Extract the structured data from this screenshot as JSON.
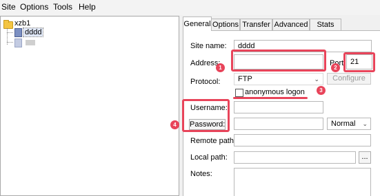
{
  "menu": {
    "items": [
      "Site",
      "Options",
      "Tools",
      "Help"
    ]
  },
  "tree": {
    "root_label": "xzb1",
    "child_label": "dddd"
  },
  "tabs": [
    "General",
    "Options",
    "Transfer",
    "Advanced",
    "Stats"
  ],
  "form": {
    "site_name_label": "Site name:",
    "site_name_value": "dddd",
    "address_label": "Address:",
    "address_value": "",
    "port_label": "Port:",
    "port_value": "21",
    "protocol_label": "Protocol:",
    "protocol_value": "FTP",
    "configure_label": "Configure",
    "anonymous_label": "anonymous logon",
    "username_label": "Username:",
    "username_value": "",
    "password_button_label": "Password:",
    "password_value": "",
    "password_mode": "Normal",
    "remote_path_label": "Remote path:",
    "remote_path_value": "",
    "local_path_label": "Local path:",
    "local_path_value": "",
    "browse_label": "...",
    "notes_label": "Notes:"
  },
  "annotations": {
    "badges": [
      "1",
      "2",
      "3",
      "4"
    ]
  },
  "colors": {
    "annotation_red": "#e8445a"
  }
}
